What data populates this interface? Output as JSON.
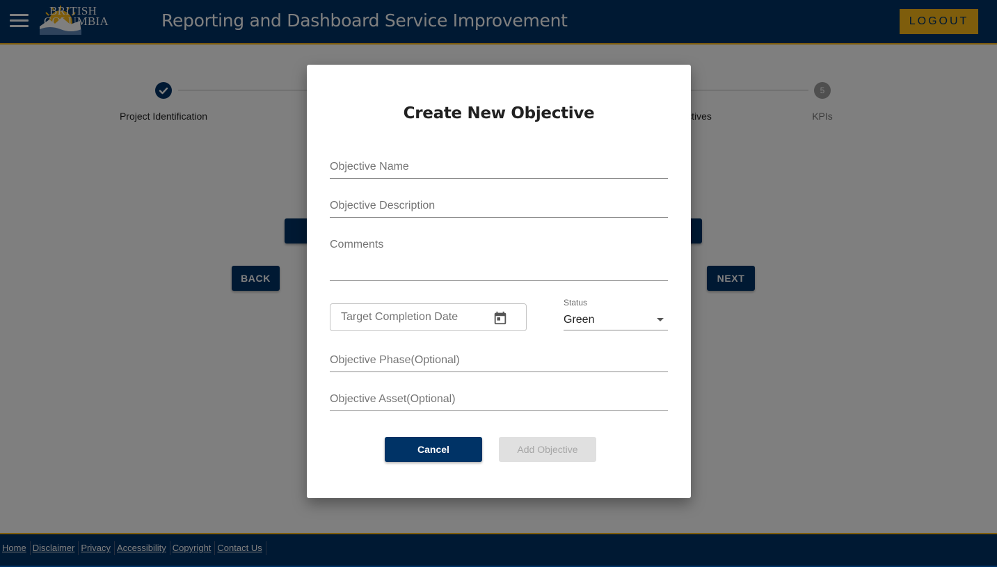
{
  "header": {
    "logo_line1": "BRITISH",
    "logo_line2": "COLUMBIA",
    "title": "Reporting and Dashboard Service Improvement",
    "logout_label": "LOGOUT",
    "accent_color": "#fcba19",
    "brand_color": "#003366"
  },
  "stepper": {
    "steps": [
      {
        "label": "Project Identification",
        "state": "completed",
        "icon": "check-icon"
      },
      {
        "label": "ctives",
        "state": "partially-hidden"
      },
      {
        "label": "KPIs",
        "number": "5",
        "state": "inactive"
      }
    ]
  },
  "main": {
    "back_label": "BACK",
    "next_label": "NEXT"
  },
  "dialog": {
    "title": "Create New Objective",
    "objective_name_placeholder": "Objective Name",
    "objective_description_placeholder": "Objective Description",
    "comments_placeholder": "Comments",
    "target_date_placeholder": "Target Completion Date",
    "status_label": "Status",
    "status_value": "Green",
    "phase_placeholder": "Objective Phase(Optional)",
    "asset_placeholder": "Objective Asset(Optional)",
    "cancel_label": "Cancel",
    "add_label": "Add Objective",
    "add_disabled": true
  },
  "footer": {
    "links": [
      "Home",
      "Disclaimer",
      "Privacy",
      "Accessibility",
      "Copyright",
      "Contact Us"
    ]
  }
}
